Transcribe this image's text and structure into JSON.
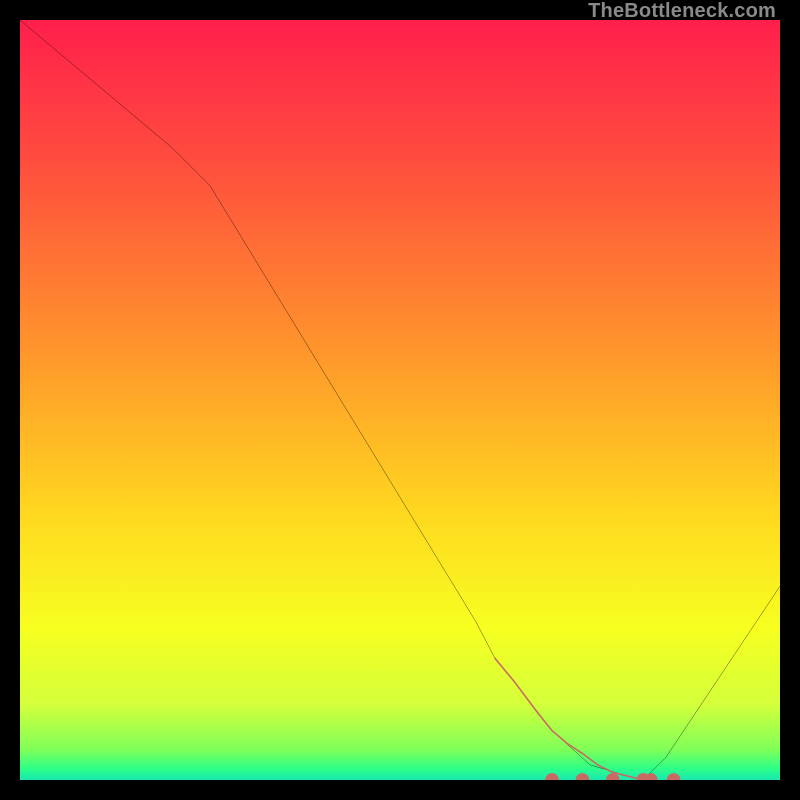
{
  "watermark": "TheBottleneck.com",
  "chart_data": {
    "type": "line",
    "title": "",
    "xlabel": "",
    "ylabel": "",
    "xlim": [
      0,
      100
    ],
    "ylim": [
      0,
      100
    ],
    "x": [
      0,
      5,
      10,
      15,
      20,
      25,
      30,
      35,
      40,
      45,
      50,
      55,
      60,
      62.5,
      65,
      70,
      75,
      80,
      82,
      85,
      90,
      95,
      100
    ],
    "values": [
      100,
      95.8,
      91.6,
      87.4,
      83.2,
      78.2,
      70.0,
      61.8,
      53.6,
      45.4,
      37.2,
      29.0,
      20.8,
      16.0,
      13.0,
      6.5,
      2.0,
      0.5,
      0,
      3.0,
      10.5,
      18.0,
      25.5
    ],
    "series": [
      {
        "name": "bottleneck-curve",
        "x": [
          0,
          5,
          10,
          15,
          20,
          25,
          30,
          35,
          40,
          45,
          50,
          55,
          60,
          62.5,
          65,
          70,
          75,
          80,
          82,
          85,
          90,
          95,
          100
        ],
        "y": [
          100,
          95.8,
          91.6,
          87.4,
          83.2,
          78.2,
          70.0,
          61.8,
          53.6,
          45.4,
          37.2,
          29.0,
          20.8,
          16.0,
          13.0,
          6.5,
          2.0,
          0.5,
          0,
          3.0,
          10.5,
          18.0,
          25.5
        ]
      }
    ],
    "highlight_segment": {
      "x": [
        62.5,
        65,
        68,
        70,
        72,
        74,
        76,
        78,
        80,
        82
      ],
      "y": [
        16.0,
        13.0,
        9.0,
        6.5,
        4.8,
        3.5,
        2.0,
        1.0,
        0.5,
        0.0
      ]
    },
    "highlight_dots": {
      "x": [
        70,
        74,
        78,
        82,
        83,
        86
      ],
      "y": [
        0.0,
        0.0,
        0.0,
        0.0,
        0.0,
        0.0
      ]
    },
    "gradient_stops": [
      {
        "offset": 0.0,
        "color": "#ff1f4b"
      },
      {
        "offset": 0.18,
        "color": "#ff4b3f"
      },
      {
        "offset": 0.45,
        "color": "#ff9a2a"
      },
      {
        "offset": 0.65,
        "color": "#ffd81f"
      },
      {
        "offset": 0.8,
        "color": "#f7ff20"
      },
      {
        "offset": 0.9,
        "color": "#d4ff3a"
      },
      {
        "offset": 0.96,
        "color": "#7fff58"
      },
      {
        "offset": 0.985,
        "color": "#2dff87"
      },
      {
        "offset": 1.0,
        "color": "#18e8b2"
      }
    ],
    "highlight_color": "#c96a63"
  }
}
